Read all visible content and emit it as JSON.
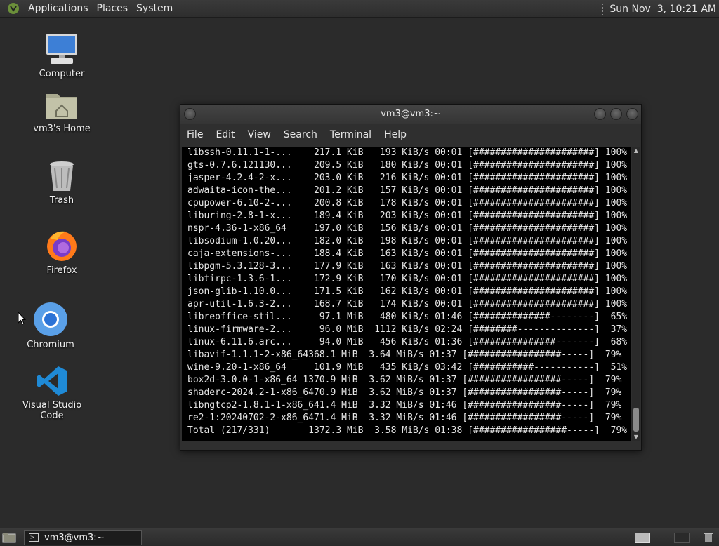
{
  "top_panel": {
    "menus": [
      "Applications",
      "Places",
      "System"
    ],
    "clock": "Sun Nov  3, 10:21 AM"
  },
  "desktop_icons": [
    {
      "label": "Computer",
      "icon": "computer-icon"
    },
    {
      "label": "vm3's Home",
      "icon": "home-folder-icon"
    },
    {
      "label": "Trash",
      "icon": "trash-icon"
    },
    {
      "label": "Firefox",
      "icon": "firefox-icon"
    },
    {
      "label": "Chromium",
      "icon": "chromium-icon"
    },
    {
      "label": "Visual Studio Code",
      "icon": "vscode-icon"
    }
  ],
  "terminal": {
    "title": "vm3@vm3:~",
    "menu": [
      "File",
      "Edit",
      "View",
      "Search",
      "Terminal",
      "Help"
    ],
    "lines": [
      "libssh-0.11.1-1-...    217.1 KiB   193 KiB/s 00:01 [######################] 100%",
      "gts-0.7.6.121130...    209.5 KiB   180 KiB/s 00:01 [######################] 100%",
      "jasper-4.2.4-2-x...    203.0 KiB   216 KiB/s 00:01 [######################] 100%",
      "adwaita-icon-the...    201.2 KiB   157 KiB/s 00:01 [######################] 100%",
      "cpupower-6.10-2-...    200.8 KiB   178 KiB/s 00:01 [######################] 100%",
      "liburing-2.8-1-x...    189.4 KiB   203 KiB/s 00:01 [######################] 100%",
      "nspr-4.36-1-x86_64     197.0 KiB   156 KiB/s 00:01 [######################] 100%",
      "libsodium-1.0.20...    182.0 KiB   198 KiB/s 00:01 [######################] 100%",
      "caja-extensions-...    188.4 KiB   163 KiB/s 00:01 [######################] 100%",
      "libpgm-5.3.128-3...    177.9 KiB   163 KiB/s 00:01 [######################] 100%",
      "libtirpc-1.3.6-1...    172.9 KiB   170 KiB/s 00:01 [######################] 100%",
      "json-glib-1.10.0...    171.5 KiB   162 KiB/s 00:01 [######################] 100%",
      "apr-util-1.6.3-2...    168.7 KiB   174 KiB/s 00:01 [######################] 100%",
      "libreoffice-stil...     97.1 MiB   480 KiB/s 01:46 [##############--------]  65%",
      "linux-firmware-2...     96.0 MiB  1112 KiB/s 02:24 [########--------------]  37%",
      "linux-6.11.6.arc...     94.0 MiB   456 KiB/s 01:36 [###############-------]  68%",
      "libavif-1.1.1-2-x86_64368.1 MiB  3.64 MiB/s 01:37 [#################-----]  79%",
      "wine-9.20-1-x86_64     101.9 MiB   435 KiB/s 03:42 [###########-----------]  51%",
      "box2d-3.0.0-1-x86_64 1370.9 MiB  3.62 MiB/s 01:37 [#################-----]  79%",
      "shaderc-2024.2-1-x86_6470.9 MiB  3.62 MiB/s 01:37 [#################-----]  79%",
      "libngtcp2-1.8.1-1-x86_641.4 MiB  3.32 MiB/s 01:46 [#################-----]  79%",
      "re2-1:20240702-2-x86_6471.4 MiB  3.32 MiB/s 01:46 [#################-----]  79%",
      "Total (217/331)       1372.3 MiB  3.58 MiB/s 01:38 [#################-----]  79%"
    ]
  },
  "taskbar": {
    "window_button": "vm3@vm3:~"
  }
}
